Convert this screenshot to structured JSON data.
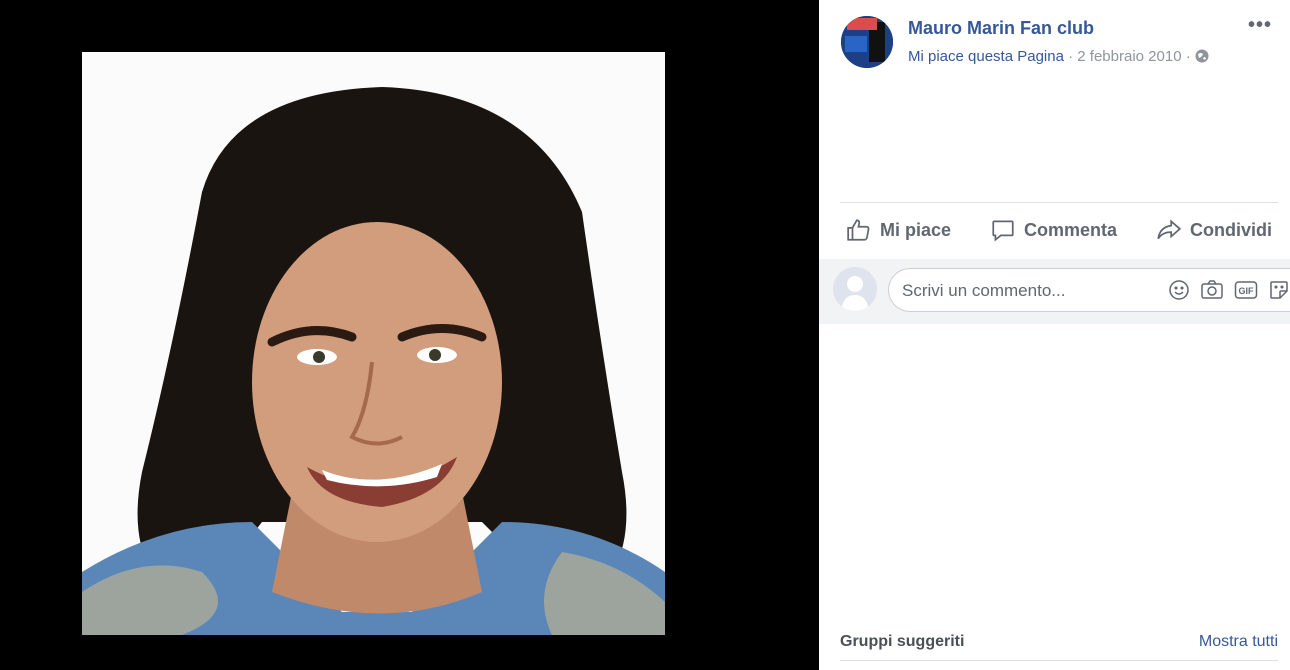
{
  "post": {
    "page_name": "Mauro Marin Fan club",
    "like_page": "Mi piace questa Pagina",
    "separator": " · ",
    "date": "2 febbraio 2010",
    "privacy_icon": "globe-icon",
    "more_label": "•••"
  },
  "photo": {
    "alt": "Foto di profilo"
  },
  "actions": [
    {
      "label": "Mi piace",
      "icon": "thumbs-up-icon"
    },
    {
      "label": "Commenta",
      "icon": "comment-icon"
    },
    {
      "label": "Condividi",
      "icon": "share-icon"
    }
  ],
  "comment": {
    "placeholder": "Scrivi un commento...",
    "icons": [
      "emoji-icon",
      "camera-icon",
      "gif-icon",
      "sticker-icon"
    ]
  },
  "sidebar": {
    "title": "Gruppi suggeriti",
    "link": "Mostra tutti"
  },
  "colors": {
    "link_blue": "#365899",
    "meta_gray": "#90949c",
    "action_gray": "#606770",
    "comment_bg": "#f2f3f5"
  }
}
